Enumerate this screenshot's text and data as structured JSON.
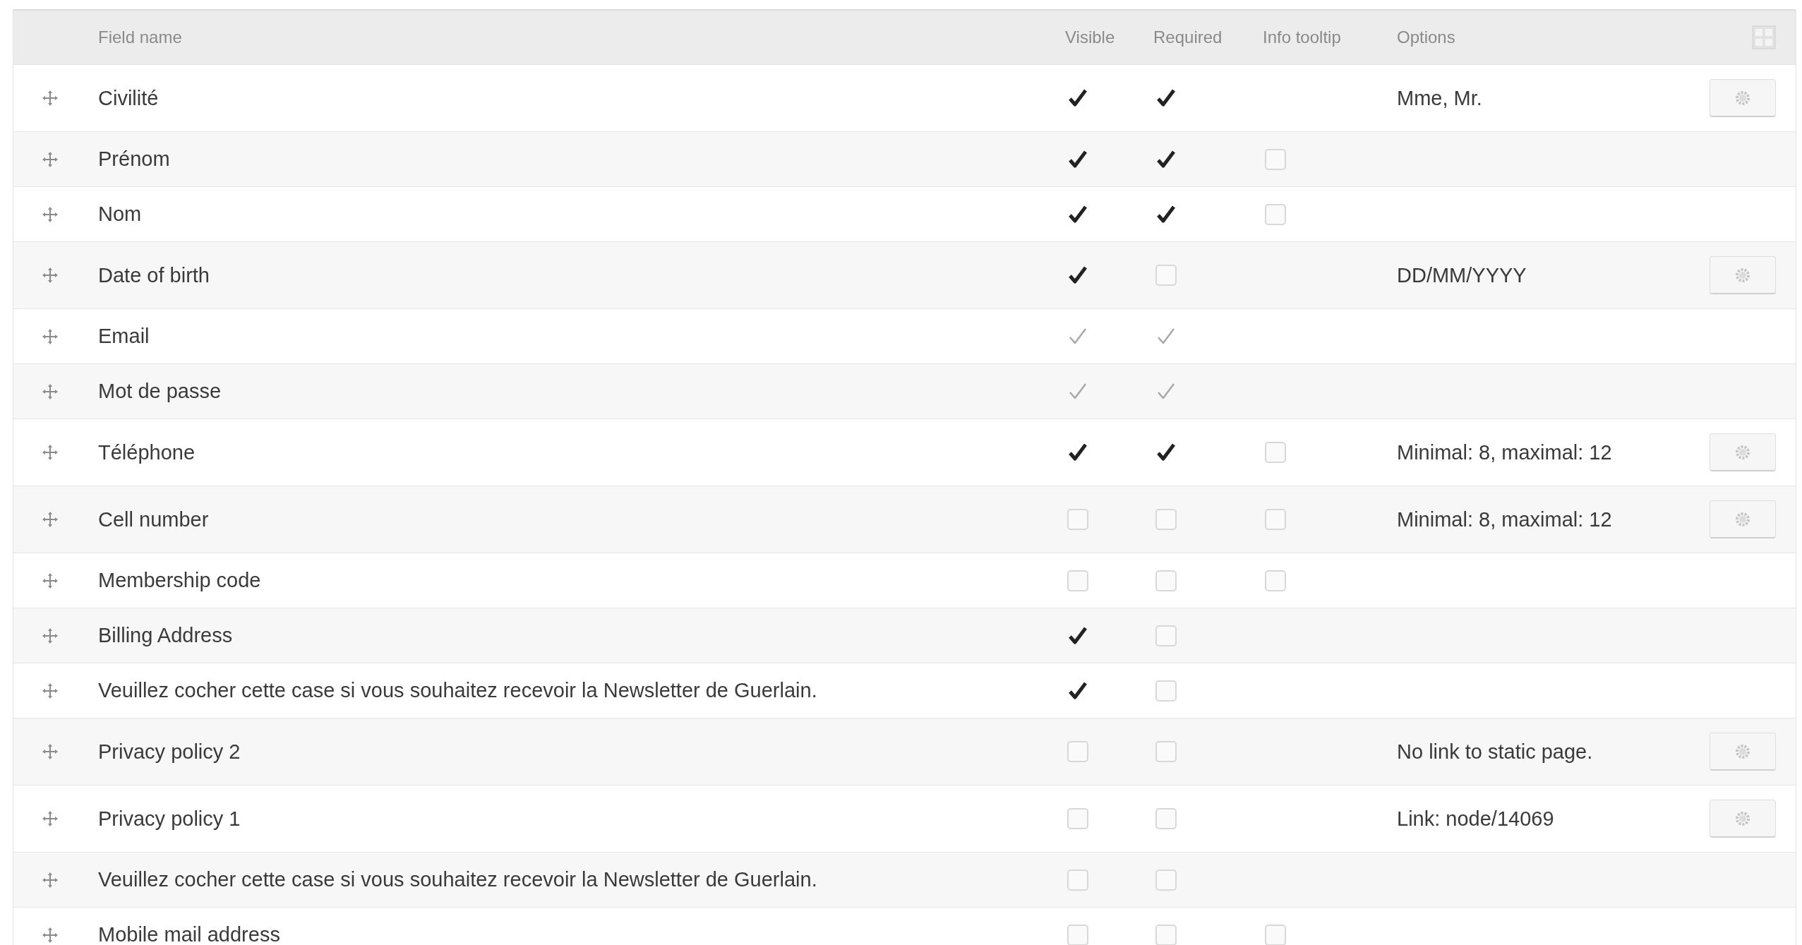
{
  "table": {
    "columns": [
      "Field name",
      "Visible",
      "Required",
      "Info tooltip",
      "Options"
    ],
    "rows": [
      {
        "name": "Civilité",
        "visible": {
          "checked": true,
          "disabled": false
        },
        "required": {
          "checked": true,
          "disabled": false
        },
        "options": "Mme, Mr.",
        "settings_button": true
      },
      {
        "name": "Prénom",
        "visible": {
          "checked": true,
          "disabled": false
        },
        "required": {
          "checked": true,
          "disabled": false
        },
        "tooltip": {
          "checked": false,
          "disabled": false
        }
      },
      {
        "name": "Nom",
        "visible": {
          "checked": true,
          "disabled": false
        },
        "required": {
          "checked": true,
          "disabled": false
        },
        "tooltip": {
          "checked": false,
          "disabled": false
        }
      },
      {
        "name": "Date of birth",
        "visible": {
          "checked": true,
          "disabled": false
        },
        "required": {
          "checked": false,
          "disabled": false
        },
        "options": "DD/MM/YYYY",
        "settings_button": true
      },
      {
        "name": "Email",
        "visible": {
          "checked": true,
          "disabled": true
        },
        "required": {
          "checked": true,
          "disabled": true
        }
      },
      {
        "name": "Mot de passe",
        "visible": {
          "checked": true,
          "disabled": true
        },
        "required": {
          "checked": true,
          "disabled": true
        }
      },
      {
        "name": "Téléphone",
        "visible": {
          "checked": true,
          "disabled": false
        },
        "required": {
          "checked": true,
          "disabled": false
        },
        "tooltip": {
          "checked": false,
          "disabled": false
        },
        "options": "Minimal: 8, maximal: 12",
        "settings_button": true
      },
      {
        "name": "Cell number",
        "visible": {
          "checked": false,
          "disabled": false
        },
        "required": {
          "checked": false,
          "disabled": false
        },
        "tooltip": {
          "checked": false,
          "disabled": false
        },
        "options": "Minimal: 8, maximal: 12",
        "settings_button": true
      },
      {
        "name": "Membership code",
        "visible": {
          "checked": false,
          "disabled": false
        },
        "required": {
          "checked": false,
          "disabled": false
        },
        "tooltip": {
          "checked": false,
          "disabled": false
        }
      },
      {
        "name": "Billing Address",
        "visible": {
          "checked": true,
          "disabled": false
        },
        "required": {
          "checked": false,
          "disabled": false
        }
      },
      {
        "name": "Veuillez cocher cette case si vous souhaitez recevoir la Newsletter de Guerlain.",
        "visible": {
          "checked": true,
          "disabled": false
        },
        "required": {
          "checked": false,
          "disabled": false
        }
      },
      {
        "name": "Privacy policy 2",
        "visible": {
          "checked": false,
          "disabled": false
        },
        "required": {
          "checked": false,
          "disabled": false
        },
        "options": "No link to static page.",
        "settings_button": true
      },
      {
        "name": "Privacy policy 1",
        "visible": {
          "checked": false,
          "disabled": false
        },
        "required": {
          "checked": false,
          "disabled": false
        },
        "options": "Link: node/14069",
        "settings_button": true
      },
      {
        "name": "Veuillez cocher cette case si vous souhaitez recevoir la Newsletter de Guerlain.",
        "visible": {
          "checked": false,
          "disabled": false
        },
        "required": {
          "checked": false,
          "disabled": false
        }
      },
      {
        "name": "Mobile mail address",
        "visible": {
          "checked": false,
          "disabled": false
        },
        "required": {
          "checked": false,
          "disabled": false
        },
        "tooltip": {
          "checked": false,
          "disabled": false
        }
      }
    ]
  }
}
